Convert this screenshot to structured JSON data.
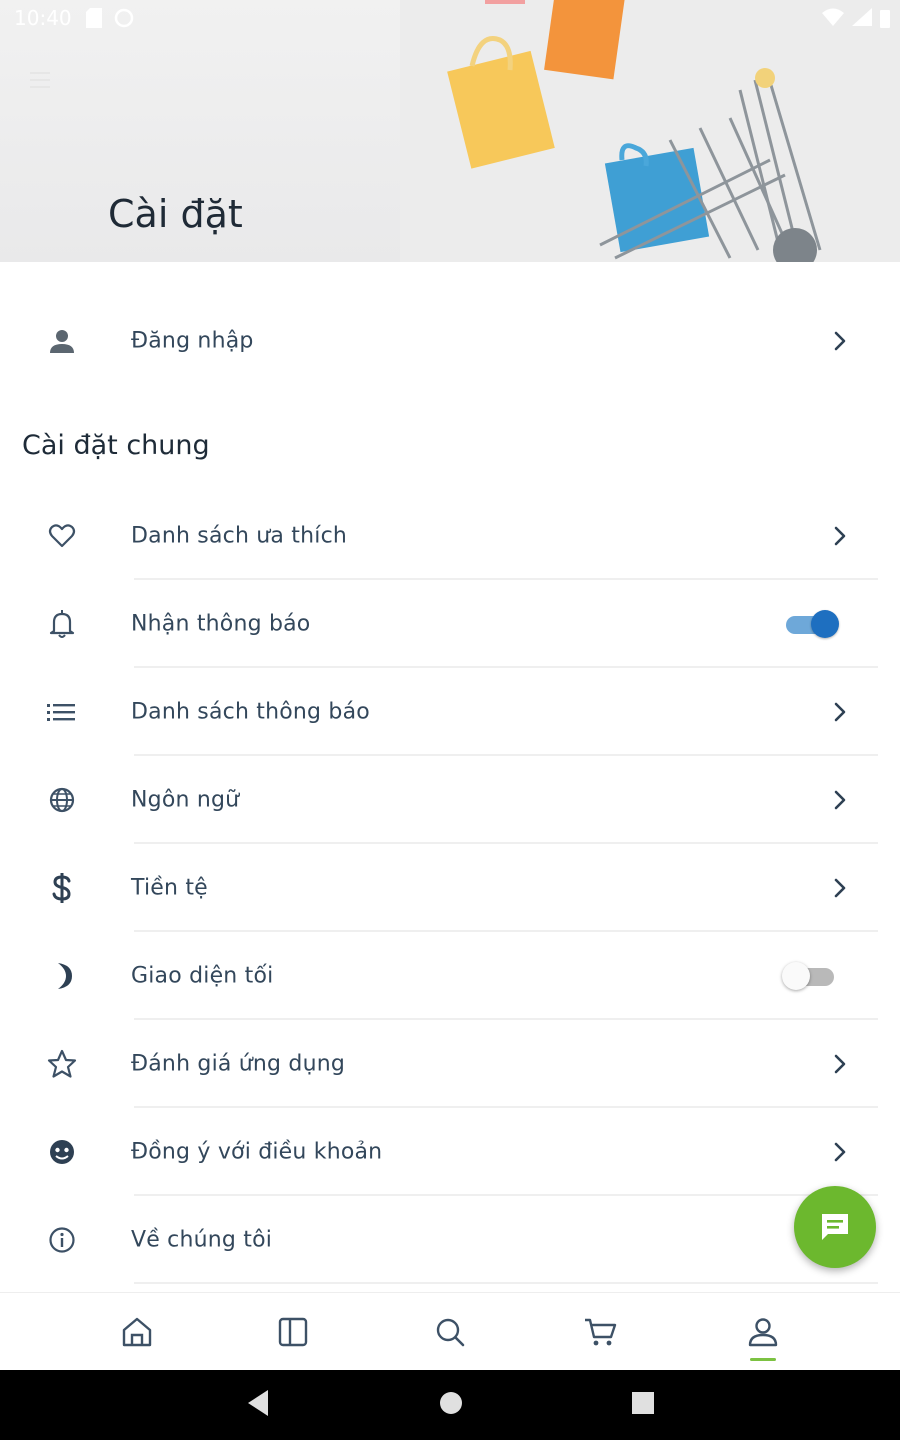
{
  "status_bar": {
    "time": "10:40"
  },
  "header": {
    "title": "Cài đặt"
  },
  "login": {
    "label": "Đăng nhập"
  },
  "general": {
    "section_title": "Cài đặt chung",
    "items": [
      {
        "label": "Danh sách ưa thích",
        "icon": "heart-icon",
        "control": "chevron"
      },
      {
        "label": "Nhận thông báo",
        "icon": "bell-icon",
        "control": "toggle",
        "on": true
      },
      {
        "label": "Danh sách thông báo",
        "icon": "list-icon",
        "control": "chevron"
      },
      {
        "label": "Ngôn ngữ",
        "icon": "globe-icon",
        "control": "chevron"
      },
      {
        "label": "Tiền tệ",
        "icon": "dollar-icon",
        "control": "chevron"
      },
      {
        "label": "Giao diện tối",
        "icon": "moon-icon",
        "control": "toggle",
        "on": false
      },
      {
        "label": "Đánh giá ứng dụng",
        "icon": "star-icon",
        "control": "chevron"
      },
      {
        "label": "Đồng ý với điều khoản",
        "icon": "terms-icon",
        "control": "chevron"
      },
      {
        "label": "Về chúng tôi",
        "icon": "info-icon",
        "control": "none"
      }
    ]
  },
  "bottom_nav": {
    "items": [
      "home-icon",
      "book-icon",
      "search-icon",
      "cart-icon",
      "profile-icon"
    ],
    "active": "profile-icon"
  },
  "colors": {
    "accent_green": "#6cb82e",
    "toggle_blue": "#1e6fc0",
    "text": "#33475b"
  }
}
